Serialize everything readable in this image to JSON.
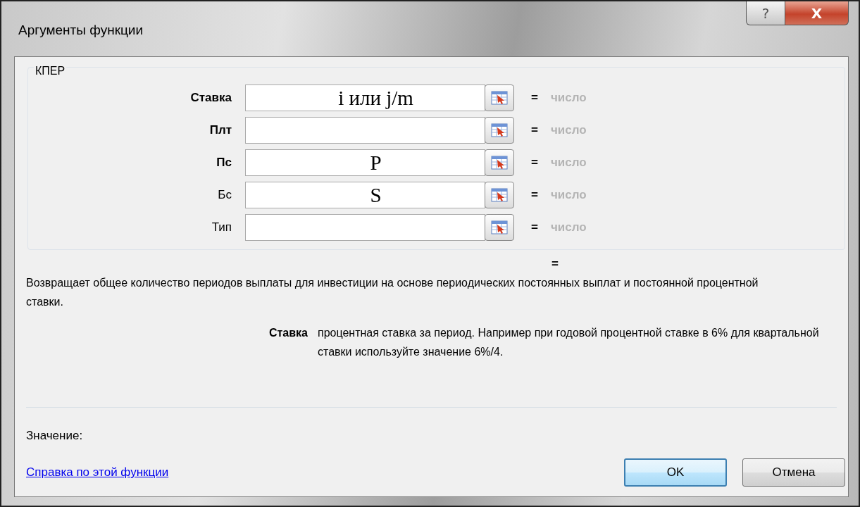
{
  "window": {
    "title": "Аргументы функции",
    "help_button": "?",
    "close_button": "X"
  },
  "function_group": {
    "title": "КПЕР",
    "arguments": [
      {
        "label": "Ставка",
        "required": true,
        "value": "i или j/m",
        "result": "=",
        "hint": "число"
      },
      {
        "label": "Плт",
        "required": true,
        "result": "=",
        "hint": "число"
      },
      {
        "label": "Пс",
        "required": true,
        "value": "P",
        "result": "=",
        "hint": "число"
      },
      {
        "label": "Бс",
        "required": false,
        "value": "S",
        "result": "=",
        "hint": "число"
      },
      {
        "label": "Тип",
        "required": false,
        "result": "=",
        "hint": "число"
      }
    ]
  },
  "formula_result": "=",
  "description": "Возвращает общее количество периодов выплаты для инвестиции на основе периодических постоянных выплат и постоянной процентной ставки.",
  "argument_help": {
    "name": "Ставка",
    "text": "процентная ставка за период. Например при годовой процентной ставке в 6% для квартальной ставки используйте значение 6%/4."
  },
  "value_label": "Значение:",
  "help_link": "Справка по этой функции",
  "buttons": [
    {
      "label": "OK",
      "default": true
    },
    {
      "label": "Отмена",
      "default": false
    }
  ]
}
